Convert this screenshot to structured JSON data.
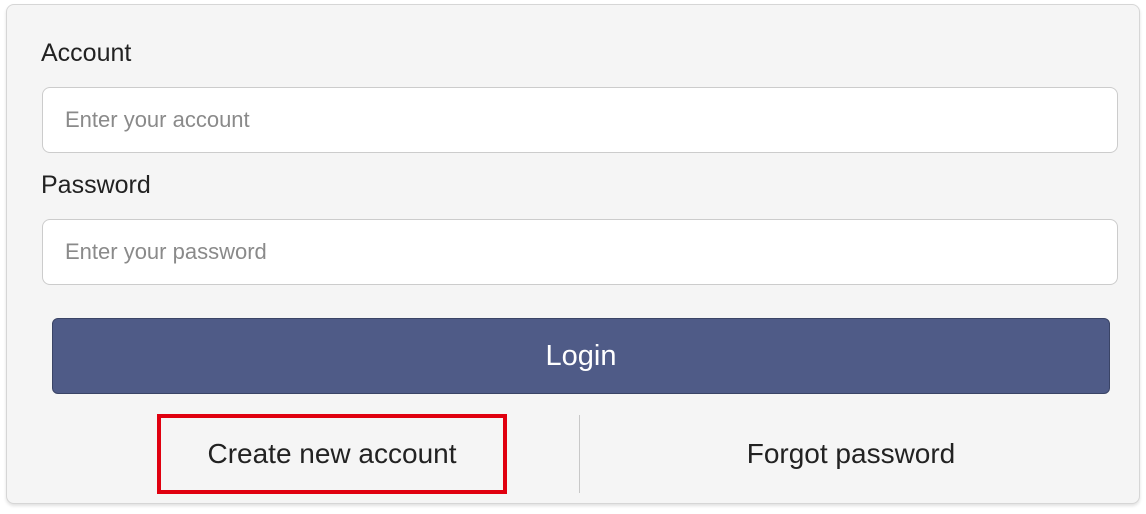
{
  "form": {
    "account_label": "Account",
    "account_placeholder": "Enter your account",
    "account_value": "",
    "password_label": "Password",
    "password_placeholder": "Enter your password",
    "password_value": "",
    "login_label": "Login",
    "create_account_label": "Create new account",
    "forgot_password_label": "Forgot password"
  },
  "colors": {
    "button_background": "#4f5b87",
    "highlight_border": "#e0000f",
    "panel_background": "#f5f5f5"
  }
}
